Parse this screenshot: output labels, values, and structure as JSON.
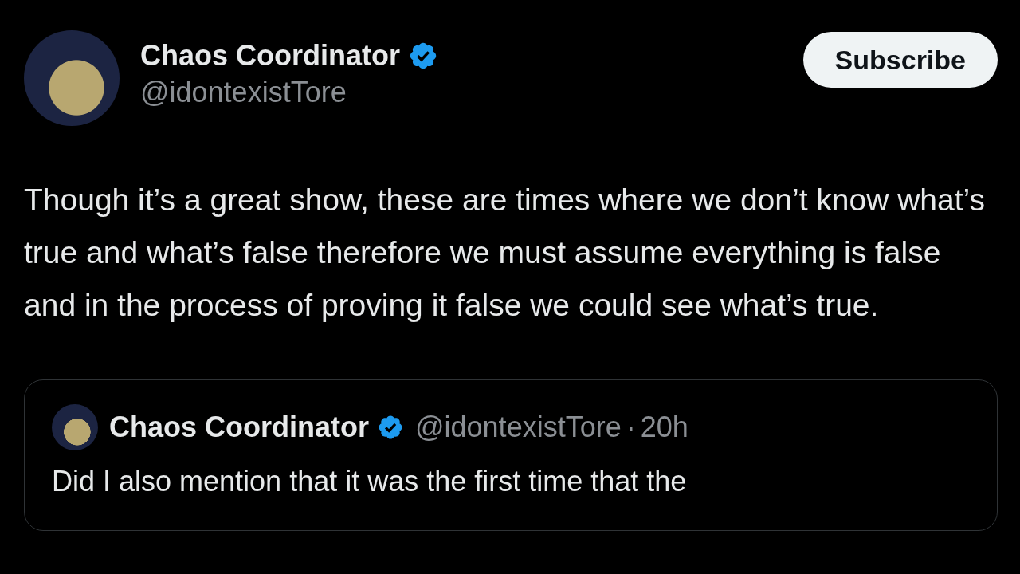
{
  "post": {
    "author": {
      "name": "Chaos Coordinator",
      "verified": true,
      "handle": "@idontexistTore"
    },
    "subscribe_button": "Subscribe",
    "text": "Though it’s a great show, these are times where we don’t know what’s true and what’s false therefore we must assume everything is false and in the process of proving it false we could see what’s true.",
    "quote": {
      "name": "Chaos Coordinator",
      "verified": true,
      "handle": "@idontexistTore",
      "separator": "·",
      "time": "20h",
      "text": "Did I also mention that it was the first time that the"
    }
  }
}
